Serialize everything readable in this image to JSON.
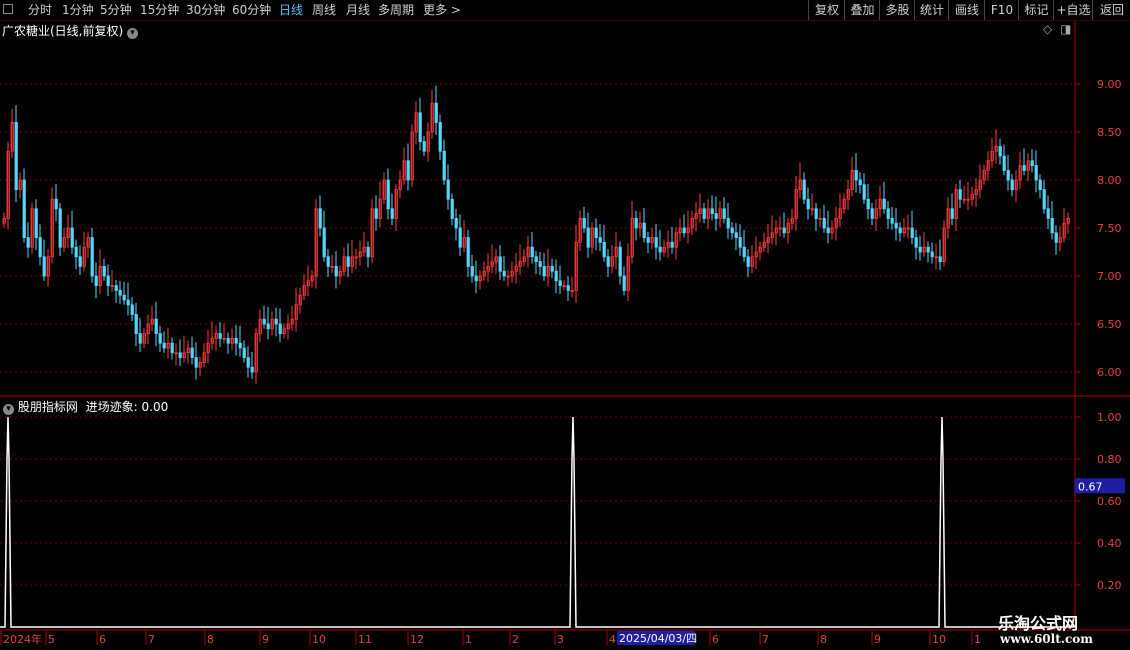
{
  "toolbar": {
    "periods": [
      "分时",
      "1分钟",
      "5分钟",
      "15分钟",
      "30分钟",
      "60分钟",
      "日线",
      "周线",
      "月线",
      "多周期",
      "更多 >"
    ],
    "active_period": "日线",
    "right_buttons": [
      "复权",
      "叠加",
      "多股",
      "统计",
      "画线",
      "F10",
      "标记",
      "+自选",
      "返回"
    ]
  },
  "main_panel": {
    "title": "广农糖业(日线,前复权)",
    "y_ticks": [
      "9.00",
      "8.50",
      "8.00",
      "7.50",
      "7.00",
      "6.50",
      "6.00"
    ]
  },
  "indicator_panel": {
    "title": "股朋指标网",
    "indicator_label": "进场迹象: 0.00",
    "y_ticks": [
      "1.00",
      "0.80",
      "0.60",
      "0.40",
      "0.20"
    ],
    "current_value": "0.67"
  },
  "time_axis": {
    "labels": [
      "2024年",
      "5",
      "6",
      "7",
      "8",
      "9",
      "10",
      "11",
      "12",
      "1",
      "2",
      "3",
      "4",
      "5",
      "6",
      "7",
      "8",
      "9",
      "10",
      "1"
    ],
    "cursor_date": "2025/04/03/四"
  },
  "watermark": {
    "line1": "乐淘公式网",
    "line2": "www.60lt.com"
  },
  "colors": {
    "up": "#ff3c3c",
    "down": "#54d7ff",
    "grid": "#7a0000",
    "axis": "#b00000",
    "signal": "#ffffff"
  },
  "chart_data": {
    "type": "candlestick",
    "title": "广农糖业(日线,前复权)",
    "price_range": [
      5.9,
      9.45
    ],
    "close_series": [
      [
        0,
        7.6
      ],
      [
        4,
        8.3
      ],
      [
        8,
        8.6
      ],
      [
        12,
        7.9
      ],
      [
        16,
        8.0
      ],
      [
        20,
        7.4
      ],
      [
        24,
        7.3
      ],
      [
        28,
        7.7
      ],
      [
        32,
        7.4
      ],
      [
        36,
        7.2
      ],
      [
        40,
        7.0
      ],
      [
        44,
        7.2
      ],
      [
        48,
        7.8
      ],
      [
        52,
        7.7
      ],
      [
        56,
        7.3
      ],
      [
        60,
        7.4
      ],
      [
        64,
        7.5
      ],
      [
        68,
        7.3
      ],
      [
        72,
        7.2
      ],
      [
        76,
        7.1
      ],
      [
        80,
        7.3
      ],
      [
        84,
        7.4
      ],
      [
        88,
        7.0
      ],
      [
        92,
        6.9
      ],
      [
        96,
        7.1
      ],
      [
        100,
        7.0
      ],
      [
        104,
        6.9
      ],
      [
        108,
        6.9
      ],
      [
        112,
        6.85
      ],
      [
        116,
        6.8
      ],
      [
        120,
        6.75
      ],
      [
        124,
        6.7
      ],
      [
        128,
        6.6
      ],
      [
        132,
        6.4
      ],
      [
        136,
        6.3
      ],
      [
        140,
        6.4
      ],
      [
        144,
        6.5
      ],
      [
        148,
        6.55
      ],
      [
        152,
        6.4
      ],
      [
        156,
        6.3
      ],
      [
        160,
        6.25
      ],
      [
        164,
        6.3
      ],
      [
        168,
        6.2
      ],
      [
        172,
        6.2
      ],
      [
        176,
        6.15
      ],
      [
        180,
        6.2
      ],
      [
        184,
        6.25
      ],
      [
        188,
        6.15
      ],
      [
        192,
        6.05
      ],
      [
        196,
        6.1
      ],
      [
        200,
        6.2
      ],
      [
        204,
        6.3
      ],
      [
        208,
        6.35
      ],
      [
        212,
        6.4
      ],
      [
        216,
        6.35
      ],
      [
        220,
        6.35
      ],
      [
        224,
        6.3
      ],
      [
        228,
        6.35
      ],
      [
        232,
        6.3
      ],
      [
        236,
        6.25
      ],
      [
        240,
        6.15
      ],
      [
        244,
        6.05
      ],
      [
        248,
        6.0
      ],
      [
        252,
        6.4
      ],
      [
        256,
        6.55
      ],
      [
        260,
        6.5
      ],
      [
        264,
        6.45
      ],
      [
        268,
        6.55
      ],
      [
        272,
        6.5
      ],
      [
        276,
        6.4
      ],
      [
        280,
        6.45
      ],
      [
        284,
        6.5
      ],
      [
        288,
        6.55
      ],
      [
        292,
        6.7
      ],
      [
        296,
        6.8
      ],
      [
        300,
        6.9
      ],
      [
        304,
        6.95
      ],
      [
        308,
        7.0
      ],
      [
        312,
        7.7
      ],
      [
        316,
        7.5
      ],
      [
        320,
        7.2
      ],
      [
        324,
        7.1
      ],
      [
        328,
        7.1
      ],
      [
        332,
        7.0
      ],
      [
        336,
        7.05
      ],
      [
        340,
        7.2
      ],
      [
        344,
        7.1
      ],
      [
        348,
        7.2
      ],
      [
        352,
        7.2
      ],
      [
        356,
        7.25
      ],
      [
        360,
        7.3
      ],
      [
        364,
        7.2
      ],
      [
        368,
        7.7
      ],
      [
        372,
        7.6
      ],
      [
        376,
        7.8
      ],
      [
        380,
        8.0
      ],
      [
        384,
        7.7
      ],
      [
        388,
        7.6
      ],
      [
        392,
        7.9
      ],
      [
        396,
        8.0
      ],
      [
        400,
        8.2
      ],
      [
        404,
        8.0
      ],
      [
        408,
        8.5
      ],
      [
        412,
        8.7
      ],
      [
        416,
        8.4
      ],
      [
        420,
        8.3
      ],
      [
        424,
        8.5
      ],
      [
        428,
        8.8
      ],
      [
        432,
        8.6
      ],
      [
        436,
        8.3
      ],
      [
        440,
        8.0
      ],
      [
        444,
        7.8
      ],
      [
        448,
        7.6
      ],
      [
        452,
        7.5
      ],
      [
        456,
        7.3
      ],
      [
        460,
        7.4
      ],
      [
        464,
        7.1
      ],
      [
        468,
        7.0
      ],
      [
        472,
        6.95
      ],
      [
        476,
        7.0
      ],
      [
        480,
        7.05
      ],
      [
        484,
        7.1
      ],
      [
        488,
        7.15
      ],
      [
        492,
        7.2
      ],
      [
        496,
        7.05
      ],
      [
        500,
        7.0
      ],
      [
        504,
        7.0
      ],
      [
        508,
        7.05
      ],
      [
        512,
        7.1
      ],
      [
        516,
        7.15
      ],
      [
        520,
        7.2
      ],
      [
        524,
        7.3
      ],
      [
        528,
        7.2
      ],
      [
        532,
        7.15
      ],
      [
        536,
        7.1
      ],
      [
        540,
        7.0
      ],
      [
        544,
        7.1
      ],
      [
        548,
        7.05
      ],
      [
        552,
        6.95
      ],
      [
        556,
        6.9
      ],
      [
        560,
        6.9
      ],
      [
        564,
        6.85
      ],
      [
        568,
        6.85
      ],
      [
        572,
        7.35
      ],
      [
        576,
        7.6
      ],
      [
        580,
        7.5
      ],
      [
        584,
        7.3
      ],
      [
        588,
        7.5
      ],
      [
        592,
        7.4
      ],
      [
        596,
        7.35
      ],
      [
        600,
        7.2
      ],
      [
        604,
        7.1
      ],
      [
        608,
        7.2
      ],
      [
        612,
        7.3
      ],
      [
        616,
        7.0
      ],
      [
        620,
        6.85
      ],
      [
        624,
        7.2
      ],
      [
        628,
        7.6
      ],
      [
        632,
        7.5
      ],
      [
        636,
        7.55
      ],
      [
        640,
        7.4
      ],
      [
        644,
        7.35
      ],
      [
        648,
        7.4
      ],
      [
        652,
        7.3
      ],
      [
        656,
        7.25
      ],
      [
        660,
        7.3
      ],
      [
        664,
        7.35
      ],
      [
        668,
        7.3
      ],
      [
        672,
        7.45
      ],
      [
        676,
        7.5
      ],
      [
        680,
        7.45
      ],
      [
        684,
        7.5
      ],
      [
        688,
        7.6
      ],
      [
        692,
        7.65
      ],
      [
        696,
        7.7
      ],
      [
        700,
        7.6
      ],
      [
        704,
        7.7
      ],
      [
        708,
        7.65
      ],
      [
        712,
        7.6
      ],
      [
        716,
        7.7
      ],
      [
        720,
        7.6
      ],
      [
        724,
        7.5
      ],
      [
        728,
        7.45
      ],
      [
        732,
        7.4
      ],
      [
        736,
        7.3
      ],
      [
        740,
        7.2
      ],
      [
        744,
        7.1
      ],
      [
        748,
        7.2
      ],
      [
        752,
        7.25
      ],
      [
        756,
        7.3
      ],
      [
        760,
        7.35
      ],
      [
        764,
        7.4
      ],
      [
        768,
        7.45
      ],
      [
        772,
        7.5
      ],
      [
        776,
        7.5
      ],
      [
        780,
        7.45
      ],
      [
        784,
        7.55
      ],
      [
        788,
        7.6
      ],
      [
        792,
        7.9
      ],
      [
        796,
        8.0
      ],
      [
        800,
        7.8
      ],
      [
        804,
        7.7
      ],
      [
        808,
        7.7
      ],
      [
        812,
        7.6
      ],
      [
        816,
        7.6
      ],
      [
        820,
        7.5
      ],
      [
        824,
        7.45
      ],
      [
        828,
        7.5
      ],
      [
        832,
        7.6
      ],
      [
        836,
        7.7
      ],
      [
        840,
        7.8
      ],
      [
        844,
        7.9
      ],
      [
        848,
        8.1
      ],
      [
        852,
        8.0
      ],
      [
        856,
        7.95
      ],
      [
        860,
        7.8
      ],
      [
        864,
        7.7
      ],
      [
        868,
        7.6
      ],
      [
        872,
        7.7
      ],
      [
        876,
        7.8
      ],
      [
        880,
        7.7
      ],
      [
        884,
        7.6
      ],
      [
        888,
        7.55
      ],
      [
        892,
        7.5
      ],
      [
        896,
        7.45
      ],
      [
        900,
        7.5
      ],
      [
        904,
        7.5
      ],
      [
        908,
        7.4
      ],
      [
        912,
        7.3
      ],
      [
        916,
        7.25
      ],
      [
        920,
        7.3
      ],
      [
        924,
        7.25
      ],
      [
        928,
        7.2
      ],
      [
        932,
        7.2
      ],
      [
        936,
        7.15
      ],
      [
        940,
        7.5
      ],
      [
        944,
        7.7
      ],
      [
        948,
        7.6
      ],
      [
        952,
        7.9
      ],
      [
        956,
        7.8
      ],
      [
        960,
        7.8
      ],
      [
        964,
        7.8
      ],
      [
        968,
        7.85
      ],
      [
        972,
        7.9
      ],
      [
        976,
        8.0
      ],
      [
        980,
        8.1
      ],
      [
        984,
        8.2
      ],
      [
        988,
        8.3
      ],
      [
        992,
        8.35
      ],
      [
        996,
        8.25
      ],
      [
        1000,
        8.1
      ],
      [
        1004,
        8.0
      ],
      [
        1008,
        7.9
      ],
      [
        1012,
        8.0
      ],
      [
        1016,
        8.15
      ],
      [
        1020,
        8.1
      ],
      [
        1024,
        8.2
      ],
      [
        1028,
        8.15
      ],
      [
        1032,
        8.0
      ],
      [
        1036,
        7.9
      ],
      [
        1040,
        7.7
      ],
      [
        1044,
        7.6
      ],
      [
        1048,
        7.45
      ],
      [
        1052,
        7.35
      ],
      [
        1056,
        7.4
      ],
      [
        1060,
        7.55
      ],
      [
        1064,
        7.6
      ]
    ],
    "signal_spikes_at": [
      8,
      573,
      942
    ],
    "signal_range": [
      0,
      1.0
    ]
  }
}
